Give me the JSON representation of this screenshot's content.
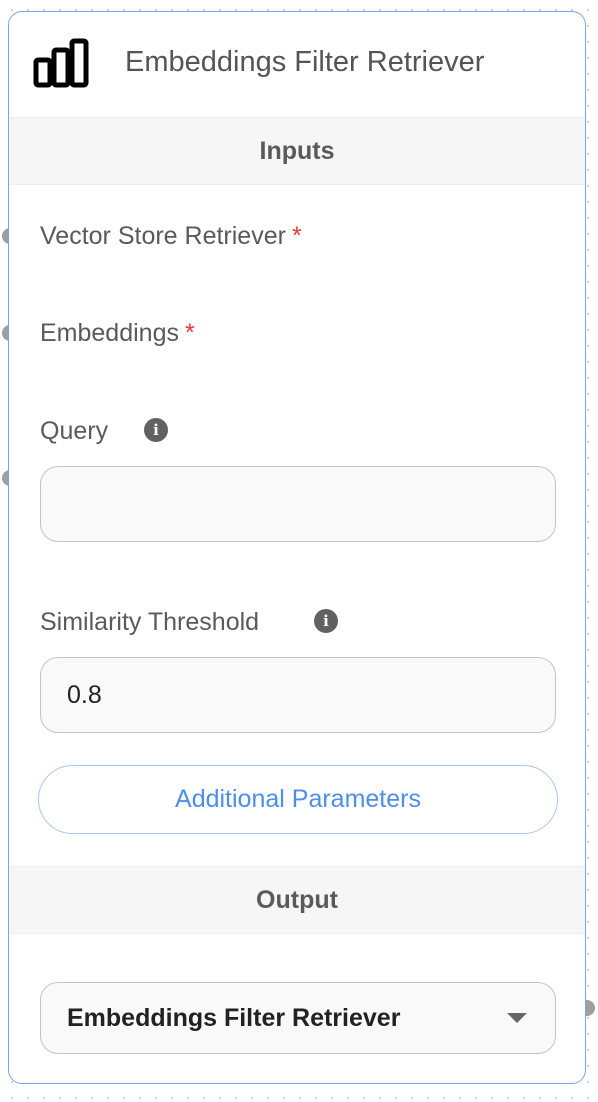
{
  "node": {
    "title": "Embeddings Filter Retriever",
    "icon": "bar-chart-icon",
    "border_color": "#7aa7e8"
  },
  "inputs": {
    "section_label": "Inputs",
    "vector_store_retriever": {
      "label": "Vector Store Retriever",
      "required_mark": "*"
    },
    "embeddings": {
      "label": "Embeddings",
      "required_mark": "*"
    },
    "query": {
      "label": "Query",
      "value": "",
      "info_icon": "info-icon"
    },
    "similarity_threshold": {
      "label": "Similarity Threshold",
      "value": "0.8",
      "info_icon": "info-icon"
    },
    "additional_parameters_label": "Additional Parameters"
  },
  "output": {
    "section_label": "Output",
    "selected": "Embeddings Filter Retriever",
    "dropdown_icon": "caret-down-icon"
  },
  "colors": {
    "accent": "#4c8ee8",
    "required": "#e53935",
    "handle": "#9e9e9e"
  }
}
